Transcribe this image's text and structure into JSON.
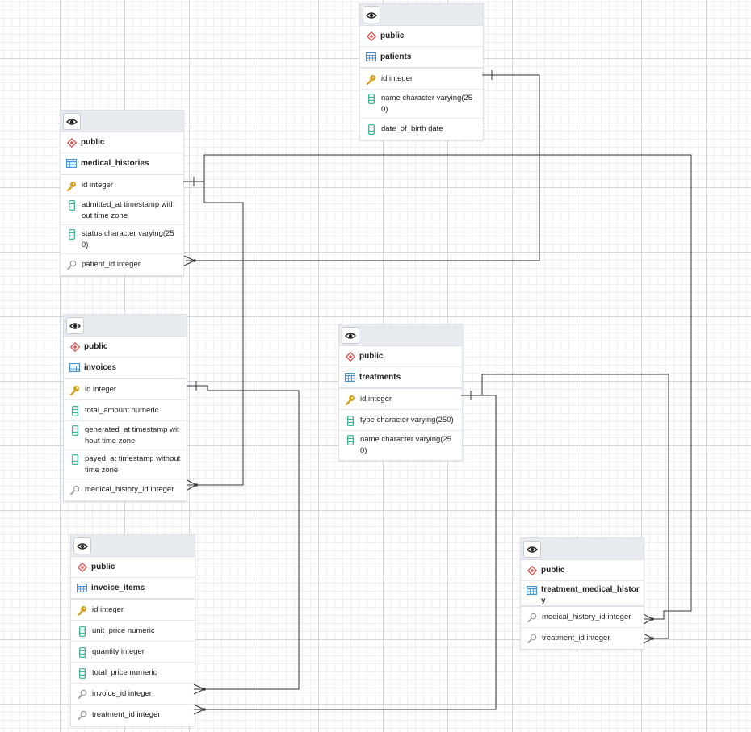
{
  "tables": [
    {
      "schema": "public",
      "name": "patients",
      "columns": [
        {
          "label": "id integer",
          "kind": "pk"
        },
        {
          "label": "name character varying(250)",
          "kind": "col"
        },
        {
          "label": "date_of_birth date",
          "kind": "col"
        }
      ]
    },
    {
      "schema": "public",
      "name": "medical_histories",
      "columns": [
        {
          "label": "id integer",
          "kind": "pk"
        },
        {
          "label": "admitted_at timestamp without time zone",
          "kind": "col"
        },
        {
          "label": "status character varying(250)",
          "kind": "col"
        },
        {
          "label": "patient_id integer",
          "kind": "fk"
        }
      ]
    },
    {
      "schema": "public",
      "name": "invoices",
      "columns": [
        {
          "label": "id integer",
          "kind": "pk"
        },
        {
          "label": "total_amount numeric",
          "kind": "col"
        },
        {
          "label": "generated_at timestamp without time zone",
          "kind": "col"
        },
        {
          "label": "payed_at timestamp without time zone",
          "kind": "col"
        },
        {
          "label": "medical_history_id integer",
          "kind": "fk"
        }
      ]
    },
    {
      "schema": "public",
      "name": "treatments",
      "columns": [
        {
          "label": "id integer",
          "kind": "pk"
        },
        {
          "label": "type character varying(250)",
          "kind": "col"
        },
        {
          "label": "name character varying(250)",
          "kind": "col"
        }
      ]
    },
    {
      "schema": "public",
      "name": "invoice_items",
      "columns": [
        {
          "label": "id integer",
          "kind": "pk"
        },
        {
          "label": "unit_price numeric",
          "kind": "col"
        },
        {
          "label": "quantity integer",
          "kind": "col"
        },
        {
          "label": "total_price numeric",
          "kind": "col"
        },
        {
          "label": "invoice_id integer",
          "kind": "fk"
        },
        {
          "label": "treatment_id integer",
          "kind": "fk"
        }
      ]
    },
    {
      "schema": "public",
      "name": "treatment_medical_history",
      "columns": [
        {
          "label": "medical_history_id integer",
          "kind": "fk"
        },
        {
          "label": "treatment_id integer",
          "kind": "fk"
        }
      ]
    }
  ],
  "relationships": [
    {
      "from": "medical_histories.patient_id",
      "to": "patients.id"
    },
    {
      "from": "invoices.medical_history_id",
      "to": "medical_histories.id"
    },
    {
      "from": "treatment_medical_history.medical_history_id",
      "to": "medical_histories.id"
    },
    {
      "from": "invoice_items.invoice_id",
      "to": "invoices.id"
    },
    {
      "from": "invoice_items.treatment_id",
      "to": "treatments.id"
    },
    {
      "from": "treatment_medical_history.treatment_id",
      "to": "treatments.id"
    }
  ],
  "colors": {
    "schema_icon": "#d9534f",
    "table_icon": "#3d8fd1",
    "pk_icon": "#d4a017",
    "column_icon": "#2eab8e",
    "fk_icon": "#9a9a9a",
    "link_line": "#333333"
  },
  "icons": {
    "toggle": "eye-icon",
    "schema": "schema-diamond-icon",
    "table": "table-grid-icon",
    "primary_key": "key-icon",
    "column": "column-icon",
    "foreign_key": "foreign-key-icon"
  }
}
